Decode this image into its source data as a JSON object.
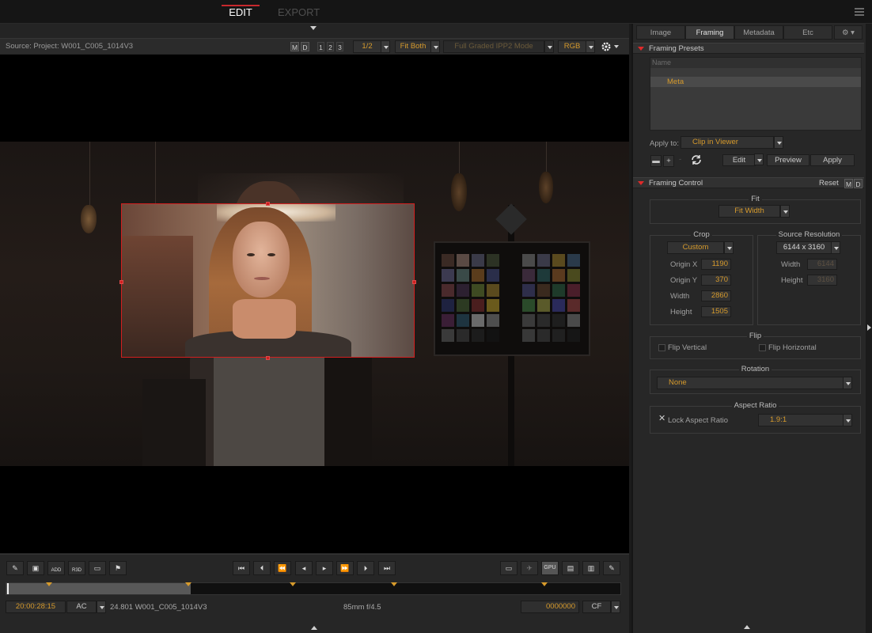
{
  "topbar": {
    "edit_label": "EDIT",
    "export_label": "EXPORT"
  },
  "viewer": {
    "source_label": "Source: Project: W001_C005_1014V3",
    "m_label": "M",
    "d_label": "D",
    "view_1": "1",
    "view_2": "2",
    "view_3": "3",
    "zoom_value": "1/2",
    "fit_value": "Fit Both",
    "pipeline_value": "Full Graded IPP2 Mode",
    "channel_value": "RGB"
  },
  "transport": {
    "add_label": "ADD",
    "r3d_label": "R3D",
    "gpu_label": "GPU",
    "timecode": "20:00:28:15",
    "tc_mode": "AC",
    "clip_info": "24.801 W001_C005_1014V3",
    "lens_info": "85mm  f/4.5",
    "frame_count": "0000000",
    "cf_mode": "CF",
    "played_fraction": 0.3,
    "markers_fraction": [
      0.07,
      0.297,
      0.466,
      0.632,
      0.876
    ]
  },
  "panel": {
    "tabs": [
      "Image",
      "Framing",
      "Metadata",
      "Etc"
    ],
    "active_tab": "Framing",
    "presets_title": "Framing Presets",
    "presets_name_header": "Name",
    "preset_item": "Meta",
    "apply_to_label": "Apply to:",
    "apply_to_value": "Clip in Viewer",
    "edit_label": "Edit",
    "preview_label": "Preview",
    "apply_label": "Apply",
    "control_title": "Framing Control",
    "reset_label": "Reset",
    "m_label": "M",
    "d_label": "D",
    "fit_title": "Fit",
    "fit_value": "Fit Width",
    "crop_title": "Crop",
    "crop_mode": "Custom",
    "origin_x_label": "Origin X",
    "origin_x": "1190",
    "origin_y_label": "Origin Y",
    "origin_y": "370",
    "width_label": "Width",
    "width": "2860",
    "height_label": "Height",
    "height": "1505",
    "source_res_title": "Source Resolution",
    "source_res_value": "6144 x 3160",
    "src_width_label": "Width",
    "src_width": "6144",
    "src_height_label": "Height",
    "src_height": "3160",
    "flip_title": "Flip",
    "flip_vertical": "Flip Vertical",
    "flip_horizontal": "Flip Horizontal",
    "rotation_title": "Rotation",
    "rotation_value": "None",
    "aspect_title": "Aspect Ratio",
    "lock_aspect": "Lock Aspect Ratio",
    "lock_aspect_checked_mark": "✕",
    "aspect_value": "1.9:1"
  },
  "colors": {
    "accent": "#d69a2c",
    "selection": "#d21f1f",
    "header_tri": "#e02a2a"
  }
}
